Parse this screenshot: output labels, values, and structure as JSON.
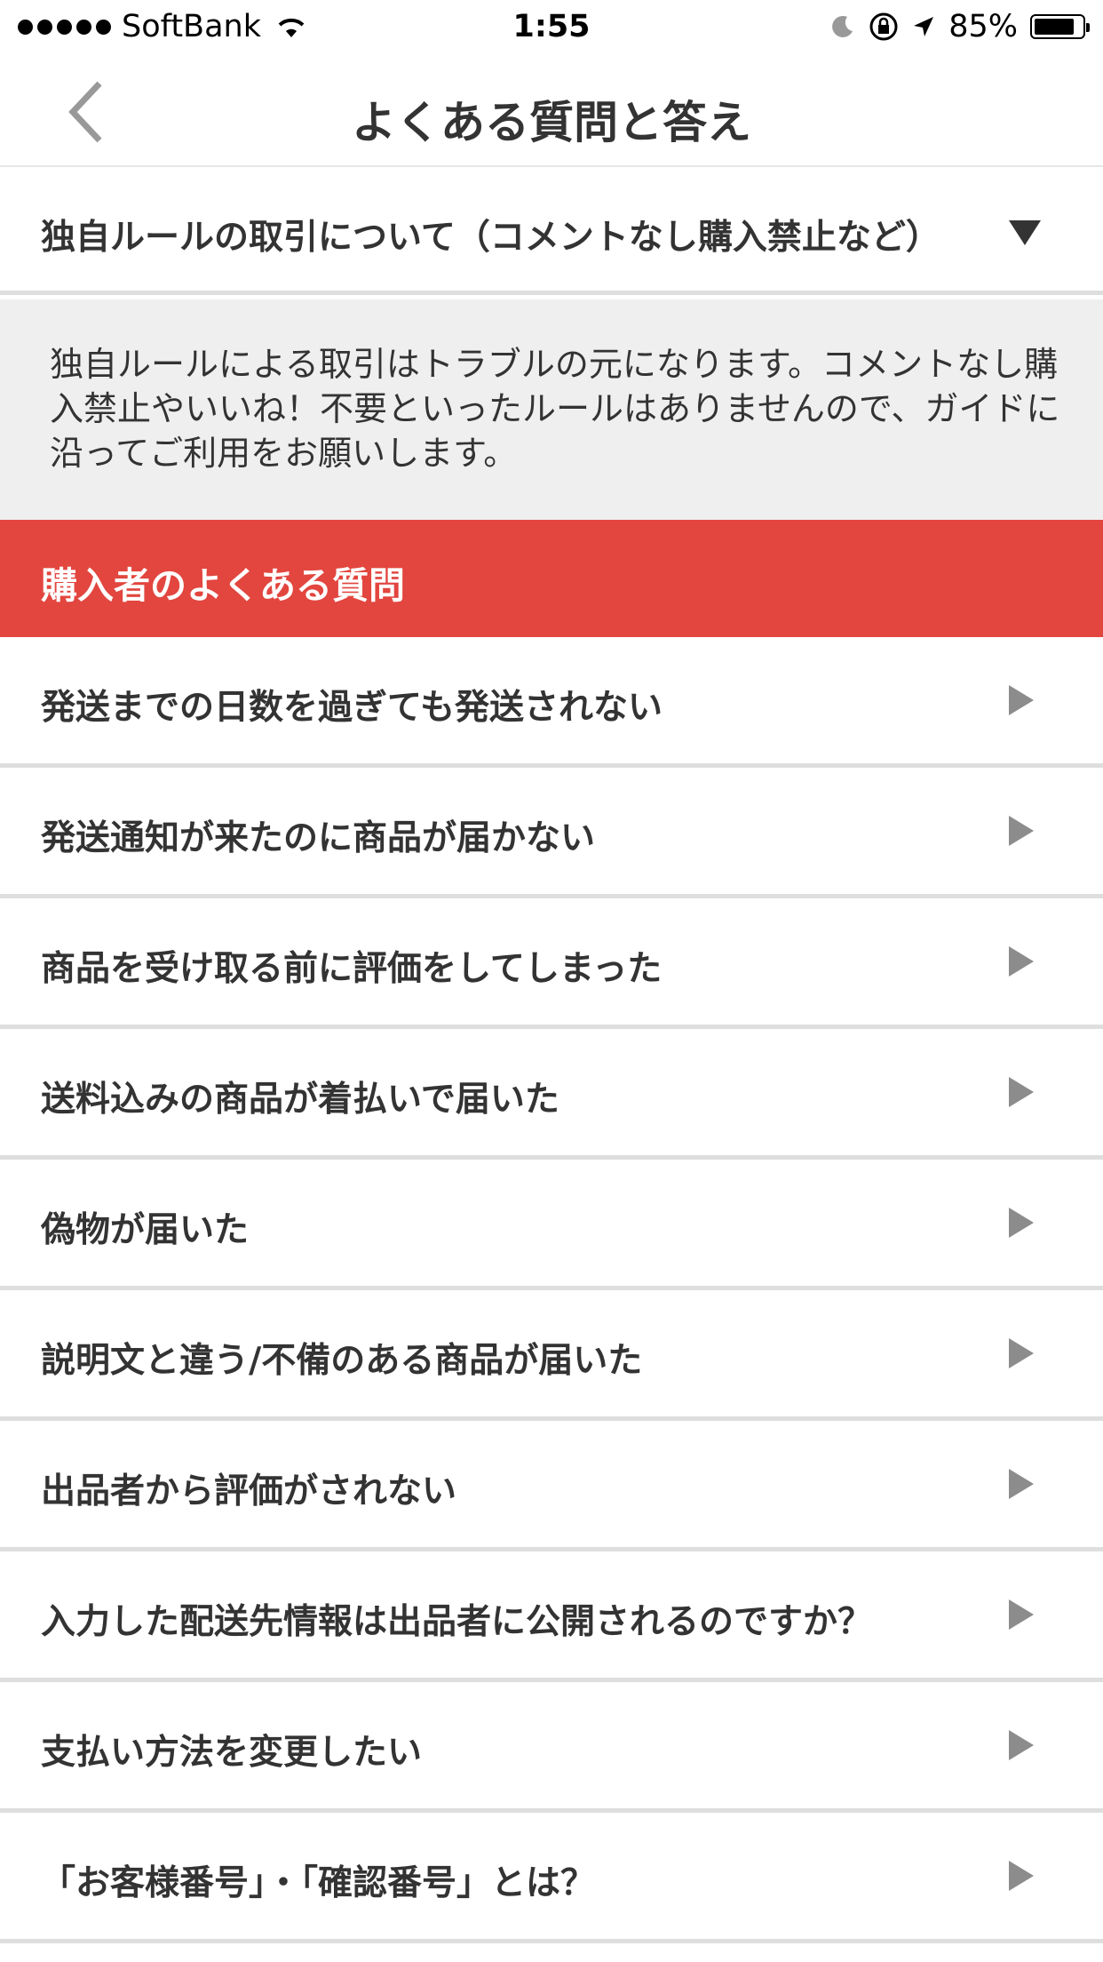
{
  "status_bar": {
    "carrier": "SoftBank",
    "time": "1:55",
    "battery": "85%",
    "battery_level": 0.85
  },
  "nav": {
    "title": "よくある質問と答え"
  },
  "expanded": {
    "title": "独自ルールの取引について（コメントなし購入禁止など）",
    "answer": "独自ルールによる取引はトラブルの元になります。コメントなし購入禁止やいいね！不要といったルールはありませんので、ガイドに沿ってご利用をお願いします。"
  },
  "section": {
    "title": "購入者のよくある質問"
  },
  "faq_items": [
    {
      "label": "発送までの日数を過ぎても発送されない"
    },
    {
      "label": "発送通知が来たのに商品が届かない"
    },
    {
      "label": "商品を受け取る前に評価をしてしまった"
    },
    {
      "label": "送料込みの商品が着払いで届いた"
    },
    {
      "label": "偽物が届いた"
    },
    {
      "label": "説明文と違う/不備のある商品が届いた"
    },
    {
      "label": "出品者から評価がされない"
    },
    {
      "label": "入力した配送先情報は出品者に公開されるのですか？"
    },
    {
      "label": "支払い方法を変更したい"
    },
    {
      "label": "「お客様番号」・「確認番号」とは？"
    }
  ],
  "icons": {
    "back": "chevron-left-icon",
    "expand": "triangle-down-icon",
    "row": "triangle-right-icon",
    "wifi": "wifi-icon",
    "moon": "moon-icon",
    "lock": "orientation-lock-icon",
    "location": "location-arrow-icon"
  },
  "colors": {
    "accent": "#e2463f",
    "text": "#333333",
    "answer_bg": "#efefef",
    "divider": "#dedede",
    "chevron": "#8c8c8c"
  }
}
